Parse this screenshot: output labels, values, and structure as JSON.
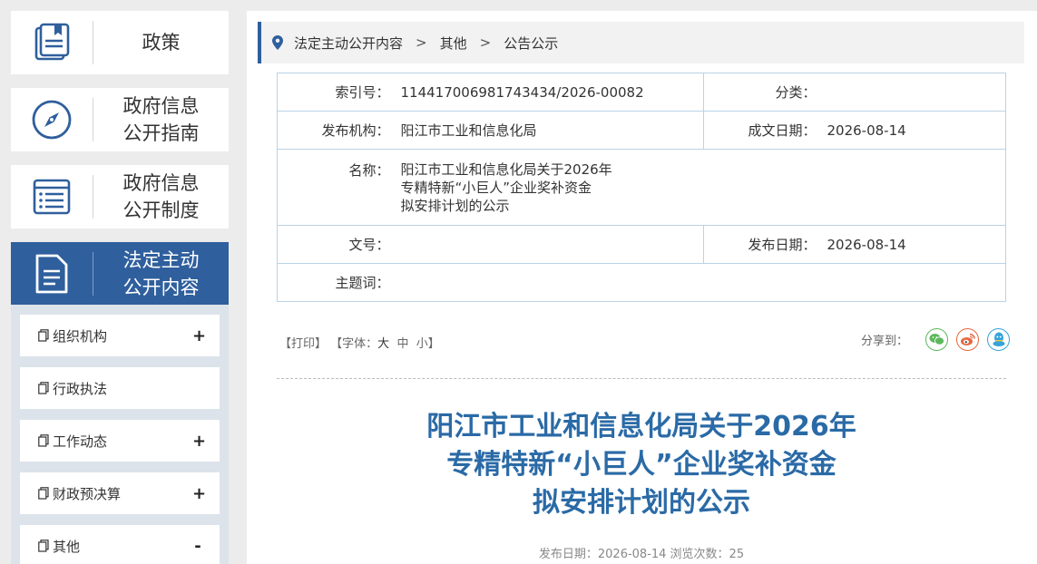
{
  "sidebar": {
    "nav": [
      {
        "label_1": "政策",
        "label_2": "",
        "icon": "book-icon"
      },
      {
        "label_1": "政府信息",
        "label_2": "公开指南",
        "icon": "compass-icon"
      },
      {
        "label_1": "政府信息",
        "label_2": "公开制度",
        "icon": "list-document-icon"
      },
      {
        "label_1": "法定主动",
        "label_2": "公开内容",
        "icon": "document-icon"
      }
    ],
    "sub_items": [
      {
        "label": "组织机构",
        "sign": "+"
      },
      {
        "label": "行政执法",
        "sign": ""
      },
      {
        "label": "工作动态",
        "sign": "+"
      },
      {
        "label": "财政预决算",
        "sign": "+"
      },
      {
        "label": "其他",
        "sign": "-"
      }
    ]
  },
  "breadcrumb": {
    "items": [
      "法定主动公开内容",
      "其他",
      "公告公示"
    ],
    "separator": ">"
  },
  "meta": {
    "index_label": "索引号：",
    "index_value": "114417006981743434/2026-00082",
    "category_label": "分类：",
    "category_value": "",
    "publisher_label": "发布机构：",
    "publisher_value": "阳江市工业和信息化局",
    "written_label": "成文日期：",
    "written_value": "2026-08-14",
    "name_label": "名称：",
    "name_line_1": "阳江市工业和信息化局关于2026年",
    "name_line_2": "专精特新“小巨人”企业奖补资金",
    "name_line_3": "拟安排计划的公示",
    "doc_no_label": "文号：",
    "doc_no_value": "",
    "pub_date_label": "发布日期：",
    "pub_date_value": "2026-08-14",
    "keyword_label": "主题词：",
    "keyword_value": ""
  },
  "tools": {
    "print": "【打印】",
    "font_prefix": "【字体：",
    "font_large": "大",
    "font_medium": "中",
    "font_small": "小",
    "font_suffix": "】"
  },
  "share": {
    "label": "分享到：",
    "wechat_color": "#5cb85c",
    "weibo_color": "#e5673f",
    "qq_color": "#35a3d9"
  },
  "article": {
    "title_line_1": "阳江市工业和信息化局关于2026年",
    "title_line_2": "专精特新“小巨人”企业奖补资金",
    "title_line_3": "拟安排计划的公示",
    "pub_info": "发布日期：2026-08-14  浏览次数：25"
  },
  "colors": {
    "accent": "#2f5f9d",
    "title": "#2a6aa6"
  }
}
